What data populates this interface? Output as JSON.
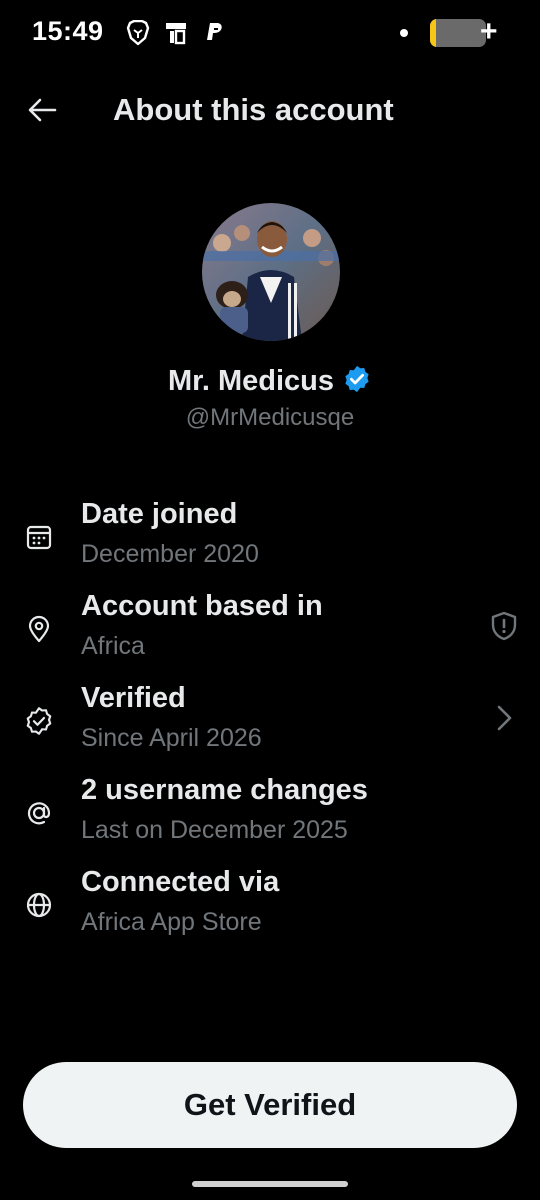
{
  "status_bar": {
    "time": "15:49",
    "battery_level": 0.1,
    "battery_color": "#f5c518",
    "icons": [
      "brave-icon",
      "cast-icon",
      "paypal-icon",
      "notification-dot",
      "battery-icon"
    ]
  },
  "header": {
    "title": "About this account",
    "back_icon": "arrow-left-icon"
  },
  "profile": {
    "display_name": "Mr. Medicus",
    "handle": "@MrMedicusqe",
    "verified_badge_color": "#1d9bf0"
  },
  "info": [
    {
      "icon": "calendar-icon",
      "title": "Date joined",
      "value": "December 2020"
    },
    {
      "icon": "location-pin-icon",
      "title": "Account based in",
      "value": "Africa",
      "action_icon": "shield-alert-icon"
    },
    {
      "icon": "verified-badge-outline-icon",
      "title": "Verified",
      "value": "Since April 2026",
      "action_icon": "chevron-right-icon"
    },
    {
      "icon": "at-sign-icon",
      "title": "2 username changes",
      "value": "Last on December 2025"
    },
    {
      "icon": "globe-icon",
      "title": "Connected via",
      "value": "Africa App Store"
    }
  ],
  "cta": {
    "label": "Get Verified"
  },
  "colors": {
    "background": "#000000",
    "primary_text": "#e7e9ea",
    "secondary_text": "#71767b",
    "button_bg": "#eff3f4"
  }
}
